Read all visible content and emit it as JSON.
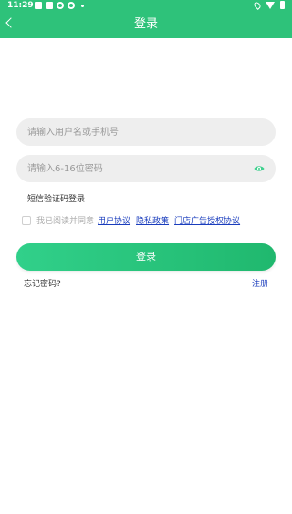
{
  "statusbar": {
    "time": "11:29"
  },
  "header": {
    "title": "登录"
  },
  "username_field": {
    "placeholder": "请输入用户名或手机号"
  },
  "password_field": {
    "placeholder": "请输入6-16位密码"
  },
  "sms_login_label": "短信验证码登录",
  "agreement": {
    "prefix": "我已阅读并同意",
    "user_agreement": "用户协议",
    "privacy_policy": "隐私政策",
    "ad_authorization": "门店广告授权协议"
  },
  "login_button": "登录",
  "forgot_password": "忘记密码?",
  "register": "注册",
  "colors": {
    "primary": "#2ec27a",
    "link": "#1a3dbd",
    "field_bg": "#eeeeee"
  }
}
